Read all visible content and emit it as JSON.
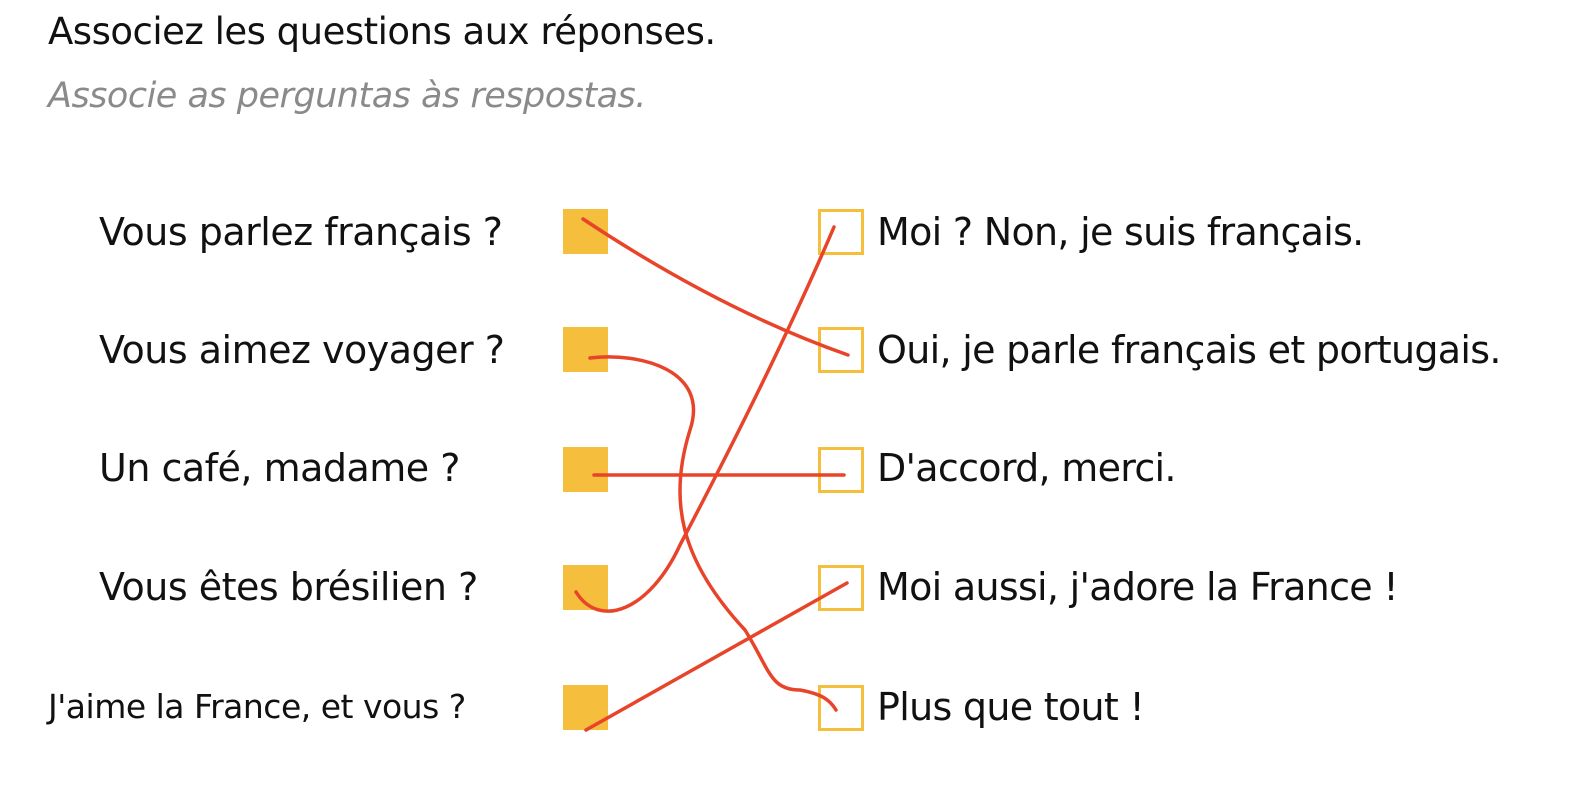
{
  "exercise": {
    "instruction": "Associez les questions aux réponses.",
    "translation": "Associe as perguntas às respostas."
  },
  "questions": [
    {
      "text": "Vous parlez français ?"
    },
    {
      "text": "Vous aimez voyager ?"
    },
    {
      "text": "Un café, madame ?"
    },
    {
      "text": "Vous êtes brésilien ?"
    },
    {
      "text": "J'aime la France, et vous ?"
    }
  ],
  "answers": [
    {
      "text": "Moi ? Non, je suis français."
    },
    {
      "text": "Oui, je parle français et portugais."
    },
    {
      "text": "D'accord, merci."
    },
    {
      "text": "Moi aussi, j'adore la France !"
    },
    {
      "text": "Plus que tout !"
    }
  ],
  "colors": {
    "box": "#f5be3c",
    "line": "#e8442a",
    "translation_text": "#8a8a8a"
  }
}
